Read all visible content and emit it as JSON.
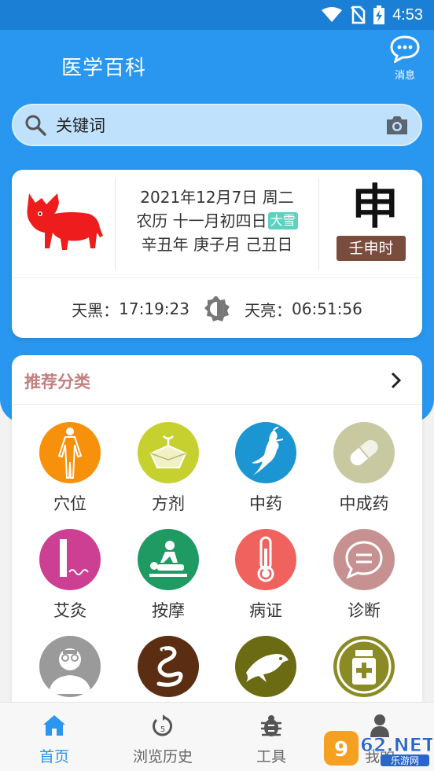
{
  "status_bar": {
    "time": "4:53"
  },
  "header": {
    "title": "医学百科",
    "message_label": "消息"
  },
  "search": {
    "placeholder": "关键词"
  },
  "calendar": {
    "solar_date": "2021年12月7日 周二",
    "lunar_date": "农历 十一月初四日",
    "solar_term": "大雪",
    "ganzhi": "辛丑年 庚子月 己丑日",
    "hour_branch": "申",
    "hour_ganzhi": "壬申时",
    "dusk_label": "天黑：",
    "dusk_time": "17:19:23",
    "dawn_label": "天亮：",
    "dawn_time": "06:51:56"
  },
  "categories": {
    "title": "推荐分类",
    "items": [
      {
        "label": "穴位",
        "icon": "acupoint-body-icon",
        "color": "#f7910b"
      },
      {
        "label": "方剂",
        "icon": "prescription-packet-icon",
        "color": "#c6d12f"
      },
      {
        "label": "中药",
        "icon": "herb-root-icon",
        "color": "#1c95d3"
      },
      {
        "label": "中成药",
        "icon": "capsule-icon",
        "color": "#c9c9a1"
      },
      {
        "label": "艾灸",
        "icon": "moxa-stick-icon",
        "color": "#cc3f93"
      },
      {
        "label": "按摩",
        "icon": "massage-icon",
        "color": "#1f9a63"
      },
      {
        "label": "病证",
        "icon": "thermometer-icon",
        "color": "#f0625e"
      },
      {
        "label": "诊断",
        "icon": "speech-bubble-icon",
        "color": "#c89191"
      },
      {
        "label": "",
        "icon": "doctor-icon",
        "color": "#9a9a9a"
      },
      {
        "label": "",
        "icon": "snake-icon",
        "color": "#5b2d12"
      },
      {
        "label": "",
        "icon": "fish-icon",
        "color": "#6b6b14"
      },
      {
        "label": "",
        "icon": "medicine-bottle-icon",
        "color": "#8b8b25"
      }
    ]
  },
  "tabbar": {
    "tabs": [
      {
        "label": "首页",
        "active": true
      },
      {
        "label": "浏览历史",
        "active": false
      },
      {
        "label": "工具",
        "active": false
      },
      {
        "label": "我的",
        "active": false
      }
    ]
  },
  "watermark": {
    "brand": "962.NET",
    "sub": "乐游网"
  },
  "colors": {
    "primary": "#2997ef",
    "statusbar": "#1c7fd6",
    "category_title": "#c27f7f",
    "hour_badge": "#7a4c3d",
    "solar_term_badge": "#5fd1c0"
  }
}
